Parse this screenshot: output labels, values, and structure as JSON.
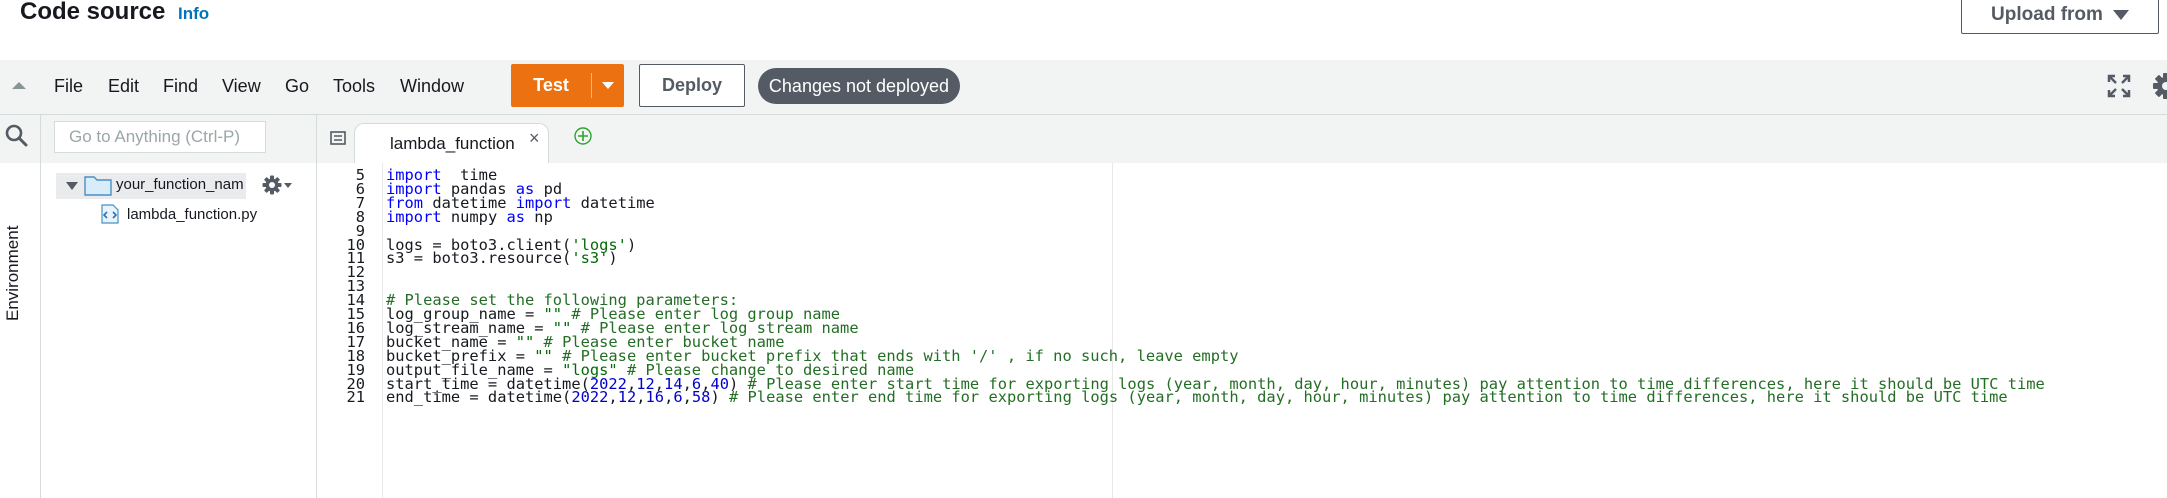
{
  "header": {
    "title": "Code source",
    "info": "Info",
    "upload_button": "Upload from"
  },
  "menubar": {
    "items": [
      "File",
      "Edit",
      "Find",
      "View",
      "Go",
      "Tools",
      "Window"
    ],
    "test_label": "Test",
    "deploy_label": "Deploy",
    "status": "Changes not deployed"
  },
  "sidebar": {
    "rail_label": "Environment",
    "search_placeholder": "Go to Anything (Ctrl-P)",
    "folder_name": "your_function_name",
    "file_name": "lambda_function.py"
  },
  "editor": {
    "active_tab": "lambda_function",
    "lines": [
      {
        "n": "5",
        "tokens": [
          [
            "kw",
            "import"
          ],
          [
            "",
            "  time"
          ]
        ]
      },
      {
        "n": "6",
        "tokens": [
          [
            "kw",
            "import"
          ],
          [
            "",
            " pandas "
          ],
          [
            "kw",
            "as"
          ],
          [
            "",
            " pd"
          ]
        ]
      },
      {
        "n": "7",
        "tokens": [
          [
            "kw",
            "from"
          ],
          [
            "",
            " datetime "
          ],
          [
            "kw",
            "import"
          ],
          [
            "",
            " datetime"
          ]
        ]
      },
      {
        "n": "8",
        "tokens": [
          [
            "kw",
            "import"
          ],
          [
            "",
            " numpy "
          ],
          [
            "kw",
            "as"
          ],
          [
            "",
            " np"
          ]
        ]
      },
      {
        "n": "9",
        "tokens": []
      },
      {
        "n": "10",
        "tokens": [
          [
            "",
            "logs = boto3.client("
          ],
          [
            "st",
            "'logs'"
          ],
          [
            "",
            ")"
          ]
        ]
      },
      {
        "n": "11",
        "tokens": [
          [
            "",
            "s3 = boto3.resource("
          ],
          [
            "st",
            "'s3'"
          ],
          [
            "",
            ")"
          ]
        ]
      },
      {
        "n": "12",
        "tokens": []
      },
      {
        "n": "13",
        "tokens": []
      },
      {
        "n": "14",
        "tokens": [
          [
            "cm",
            "# Please set the following parameters:"
          ]
        ]
      },
      {
        "n": "15",
        "tokens": [
          [
            "",
            "log_group_name = "
          ],
          [
            "st",
            "\"\""
          ],
          [
            "cm",
            " # Please enter log group name"
          ]
        ]
      },
      {
        "n": "16",
        "tokens": [
          [
            "",
            "log_stream_name = "
          ],
          [
            "st",
            "\"\""
          ],
          [
            "cm",
            " # Please enter log stream name"
          ]
        ]
      },
      {
        "n": "17",
        "tokens": [
          [
            "",
            "bucket_name = "
          ],
          [
            "st",
            "\"\""
          ],
          [
            "cm",
            " # Please enter bucket name"
          ]
        ]
      },
      {
        "n": "18",
        "tokens": [
          [
            "",
            "bucket_prefix = "
          ],
          [
            "st",
            "\"\""
          ],
          [
            "cm",
            " # Please enter bucket prefix that ends with '/' , if no such, leave empty"
          ]
        ]
      },
      {
        "n": "19",
        "tokens": [
          [
            "",
            "output_file_name = "
          ],
          [
            "st",
            "\"logs\""
          ],
          [
            "cm",
            " # Please change to desired name"
          ]
        ]
      },
      {
        "n": "20",
        "tokens": [
          [
            "",
            "start_time = datetime("
          ],
          [
            "nm",
            "2022"
          ],
          [
            "",
            ","
          ],
          [
            "nm",
            "12"
          ],
          [
            "",
            ","
          ],
          [
            "nm",
            "14"
          ],
          [
            "",
            ","
          ],
          [
            "nm",
            "6"
          ],
          [
            "",
            ","
          ],
          [
            "nm",
            "40"
          ],
          [
            "",
            ")"
          ],
          [
            "cm",
            " # Please enter start time for exporting logs (year, month, day, hour, minutes) pay attention to time differences, here it should be UTC time"
          ]
        ]
      },
      {
        "n": "21",
        "tokens": [
          [
            "",
            "end_time = datetime("
          ],
          [
            "nm",
            "2022"
          ],
          [
            "",
            ","
          ],
          [
            "nm",
            "12"
          ],
          [
            "",
            ","
          ],
          [
            "nm",
            "16"
          ],
          [
            "",
            ","
          ],
          [
            "nm",
            "6"
          ],
          [
            "",
            ","
          ],
          [
            "nm",
            "58"
          ],
          [
            "",
            ")"
          ],
          [
            "cm",
            " # Please enter end time for exporting logs (year, month, day, hour, minutes) pay attention to time differences, here it should be UTC time"
          ]
        ]
      }
    ]
  },
  "icons": {
    "collapse": "caret-up-icon",
    "fullscreen": "fullscreen-icon",
    "settings": "gear-icon",
    "search": "search-icon",
    "folder": "folder-icon",
    "file": "python-file-icon",
    "add_tab": "add-tab-icon"
  },
  "colors": {
    "primary": "#ec7211",
    "status_badge": "#545b64",
    "link": "#0073bb"
  }
}
